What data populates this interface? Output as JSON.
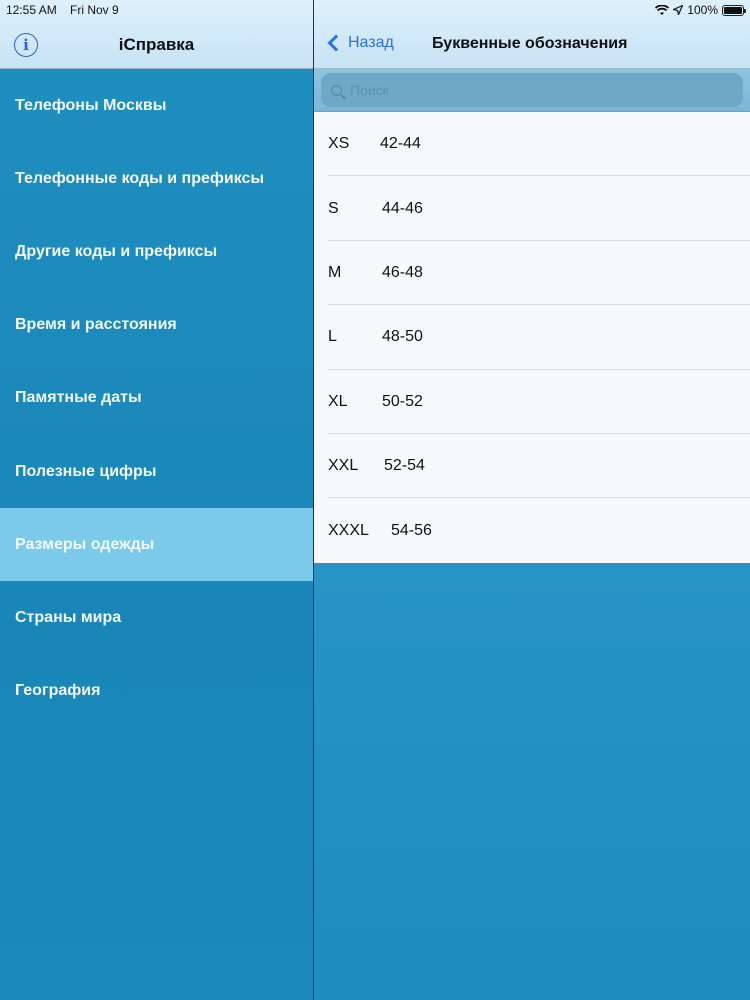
{
  "status": {
    "time": "12:55 AM",
    "date": "Fri Nov 9",
    "battery": "100%"
  },
  "left": {
    "title": "iСправка",
    "info_icon": "info-icon",
    "menu": [
      {
        "label": "Телефоны Москвы"
      },
      {
        "label": "Телефонные коды и префиксы"
      },
      {
        "label": "Другие коды и префиксы"
      },
      {
        "label": "Время и расстояния"
      },
      {
        "label": "Памятные даты"
      },
      {
        "label": "Полезные цифры"
      },
      {
        "label": "Размеры одежды",
        "selected": true
      },
      {
        "label": "Страны мира"
      },
      {
        "label": "География"
      }
    ]
  },
  "right": {
    "back_label": "Назад",
    "title": "Буквенные обозначения",
    "search": {
      "placeholder": "Поиск"
    },
    "sizes": [
      {
        "label": "XS",
        "range": "42-44"
      },
      {
        "label": "S",
        "range": "44-46"
      },
      {
        "label": "M",
        "range": "46-48"
      },
      {
        "label": "L",
        "range": "48-50"
      },
      {
        "label": "XL",
        "range": "50-52"
      },
      {
        "label": "XXL",
        "range": "52-54"
      },
      {
        "label": "XXXL",
        "range": "54-56"
      }
    ]
  },
  "colors": {
    "accent": "#2a72d8",
    "selected_row": "#7ccaea",
    "sidebar": "#1f8fbf"
  }
}
